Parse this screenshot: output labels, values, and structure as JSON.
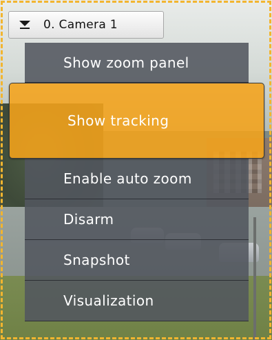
{
  "camera_selector": {
    "label": "0. Camera 1"
  },
  "context_menu": {
    "items": [
      {
        "label": "Show zoom panel",
        "highlighted": false
      },
      {
        "label": "Show tracking",
        "highlighted": true
      },
      {
        "label": "Enable auto zoom",
        "highlighted": false
      },
      {
        "label": "Disarm",
        "highlighted": false
      },
      {
        "label": "Snapshot",
        "highlighted": false
      },
      {
        "label": "Visualization",
        "highlighted": false
      }
    ]
  },
  "colors": {
    "accent": "#f2b52f",
    "highlight": "#f5a31a",
    "menu_bg": "#52565f",
    "menu_text": "#ffffff"
  },
  "icons": {
    "camera_selector": "dropdown-arrow-icon"
  }
}
